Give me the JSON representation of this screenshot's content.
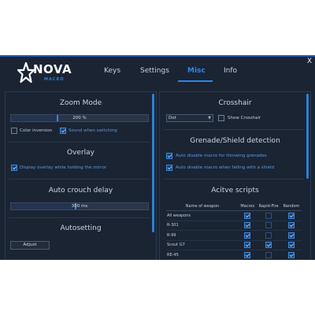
{
  "window": {
    "close_label": "X"
  },
  "logo": {
    "word": "NOVA",
    "sub": "MACRO"
  },
  "tabs": [
    {
      "label": "Keys",
      "active": false
    },
    {
      "label": "Settings",
      "active": false
    },
    {
      "label": "Misc",
      "active": true
    },
    {
      "label": "Info",
      "active": false
    }
  ],
  "left": {
    "zoom": {
      "title": "Zoom Mode",
      "slider_value": "200 %",
      "slider_fraction": 0.34,
      "color_inversion": {
        "label": "Color inversion",
        "checked": false
      },
      "sound_switching": {
        "label": "Sound when switching",
        "checked": true
      }
    },
    "overlay": {
      "title": "Overlay",
      "display_holding": {
        "label": "Display overlay while holding the mirror",
        "checked": true
      }
    },
    "crouch": {
      "title": "Auto crouch delay",
      "slider_value": "300 ms",
      "slider_fraction": 0.47
    },
    "autosetting": {
      "title": "Autosetting",
      "adjust_label": "Adjust"
    }
  },
  "right": {
    "crosshair": {
      "title": "Crosshair",
      "dropdown_value": "Dot",
      "show_crosshair": {
        "label": "Show Crosshair",
        "checked": false
      }
    },
    "grenade": {
      "title": "Grenade/Shield detection",
      "throwing": {
        "label": "Auto disable macro for throwing grenades",
        "checked": true
      },
      "shield": {
        "label": "Auto disable macro when falling with a shield",
        "checked": true
      }
    },
    "scripts": {
      "title": "Acitve scripts",
      "columns": [
        "Name of weapon",
        "Macros",
        "Rapid-Fire",
        "Random"
      ],
      "rows": [
        {
          "name": "All weapons",
          "macros": true,
          "rapid": false,
          "random": true
        },
        {
          "name": "R-301",
          "macros": true,
          "rapid": false,
          "random": true
        },
        {
          "name": "R-99",
          "macros": true,
          "rapid": false,
          "random": true
        },
        {
          "name": "Scout G7",
          "macros": true,
          "rapid": true,
          "random": true
        },
        {
          "name": "RE-45",
          "macros": true,
          "rapid": false,
          "random": true
        }
      ]
    }
  },
  "colors": {
    "accent": "#2f86e8",
    "background": "#1b2433",
    "panel_border": "#2c3a50"
  }
}
